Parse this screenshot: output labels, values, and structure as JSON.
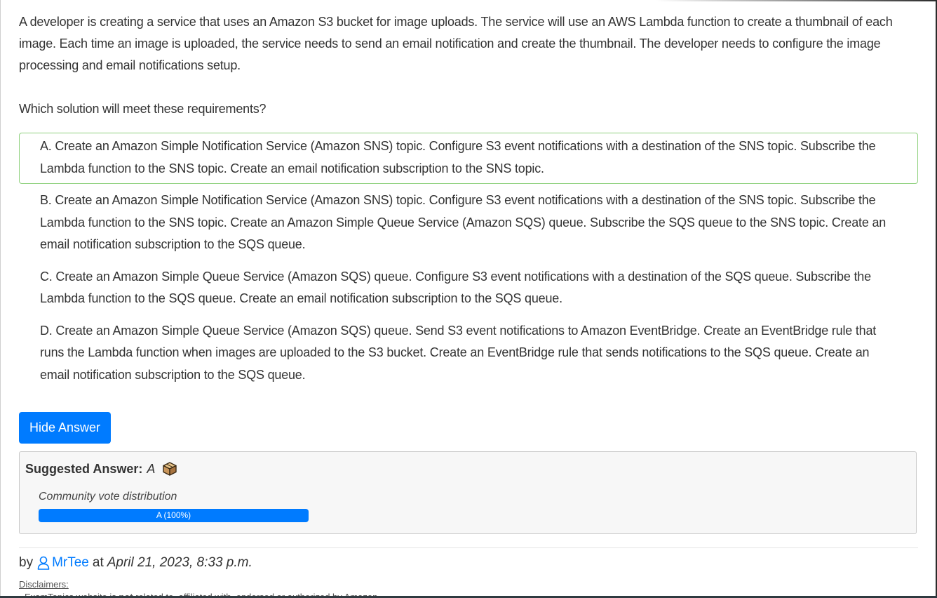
{
  "question": {
    "text": "A developer is creating a service that uses an Amazon S3 bucket for image uploads. The service will use an AWS Lambda function to create a thumbnail of each image. Each time an image is uploaded, the service needs to send an email notification and create the thumbnail. The developer needs to configure the image processing and email notifications setup.",
    "prompt": "Which solution will meet these requirements?"
  },
  "choices": [
    {
      "text": "A. Create an Amazon Simple Notification Service (Amazon SNS) topic. Configure S3 event notifications with a destination of the SNS topic. Subscribe the Lambda function to the SNS topic. Create an email notification subscription to the SNS topic.",
      "correct": true
    },
    {
      "text": "B. Create an Amazon Simple Notification Service (Amazon SNS) topic. Configure S3 event notifications with a destination of the SNS topic. Subscribe the Lambda function to the SNS topic. Create an Amazon Simple Queue Service (Amazon SQS) queue. Subscribe the SQS queue to the SNS topic. Create an email notification subscription to the SQS queue.",
      "correct": false
    },
    {
      "text": "C. Create an Amazon Simple Queue Service (Amazon SQS) queue. Configure S3 event notifications with a destination of the SQS queue. Subscribe the Lambda function to the SQS queue. Create an email notification subscription to the SQS queue.",
      "correct": false
    },
    {
      "text": "D. Create an Amazon Simple Queue Service (Amazon SQS) queue. Send S3 event notifications to Amazon EventBridge. Create an EventBridge rule that runs the Lambda function when images are uploaded to the S3 bucket. Create an EventBridge rule that sends notifications to the SQS queue. Create an email notification subscription to the SQS queue.",
      "correct": false
    }
  ],
  "hide_answer_label": "Hide Answer",
  "answer": {
    "label": "Suggested Answer:",
    "value": "A",
    "icon": "box-icon",
    "vote_label": "Community vote distribution",
    "vote_text": "A (100%)",
    "vote_percent": 100
  },
  "byline": {
    "by": "by",
    "username": "MrTee",
    "at": "at",
    "date": "April 21, 2023, 8:33 p.m."
  },
  "disclaimers": {
    "title": "Disclaimers:",
    "line_prefix": "- ExamTopics website is ",
    "line_bold": "not",
    "line_suffix": " related to, affiliated with, endorsed or authorized by Amazon."
  },
  "colors": {
    "accent": "#007bff",
    "correct_border": "#8fd17e"
  }
}
